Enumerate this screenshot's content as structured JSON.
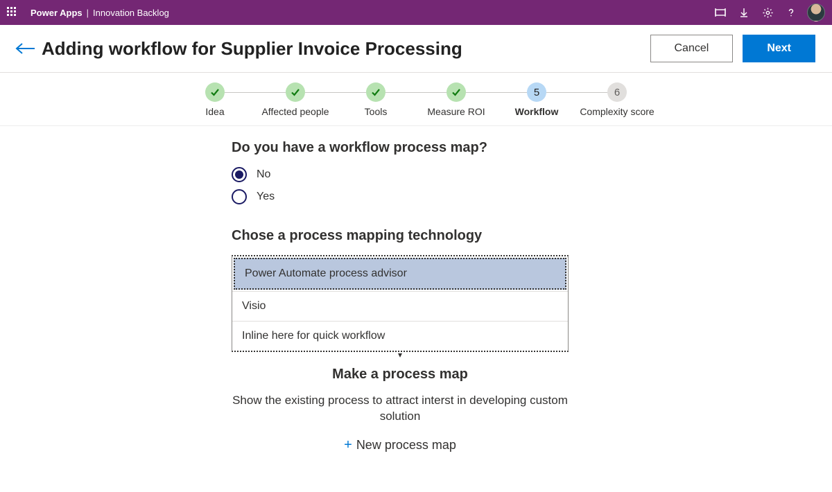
{
  "topbar": {
    "brand": "Power Apps",
    "app": "Innovation Backlog"
  },
  "header": {
    "title": "Adding workflow for Supplier Invoice Processing",
    "cancel": "Cancel",
    "next": "Next"
  },
  "stepper": [
    {
      "label": "Idea",
      "state": "done"
    },
    {
      "label": "Affected people",
      "state": "done"
    },
    {
      "label": "Tools",
      "state": "done"
    },
    {
      "label": "Measure ROI",
      "state": "done"
    },
    {
      "label": "Workflow",
      "state": "current",
      "num": "5"
    },
    {
      "label": "Complexity score",
      "state": "future",
      "num": "6"
    }
  ],
  "q1": {
    "prompt": "Do you have a workflow process map?",
    "options": [
      "No",
      "Yes"
    ],
    "selected": "No"
  },
  "q2": {
    "prompt": "Chose a process mapping technology",
    "options": [
      "Power Automate process advisor",
      "Visio",
      "Inline here for quick workflow"
    ],
    "selected": "Power Automate process advisor"
  },
  "cta": {
    "heading": "Make a process map",
    "sub": "Show the existing process to attract interst in developing custom solution",
    "new": "New process map"
  }
}
